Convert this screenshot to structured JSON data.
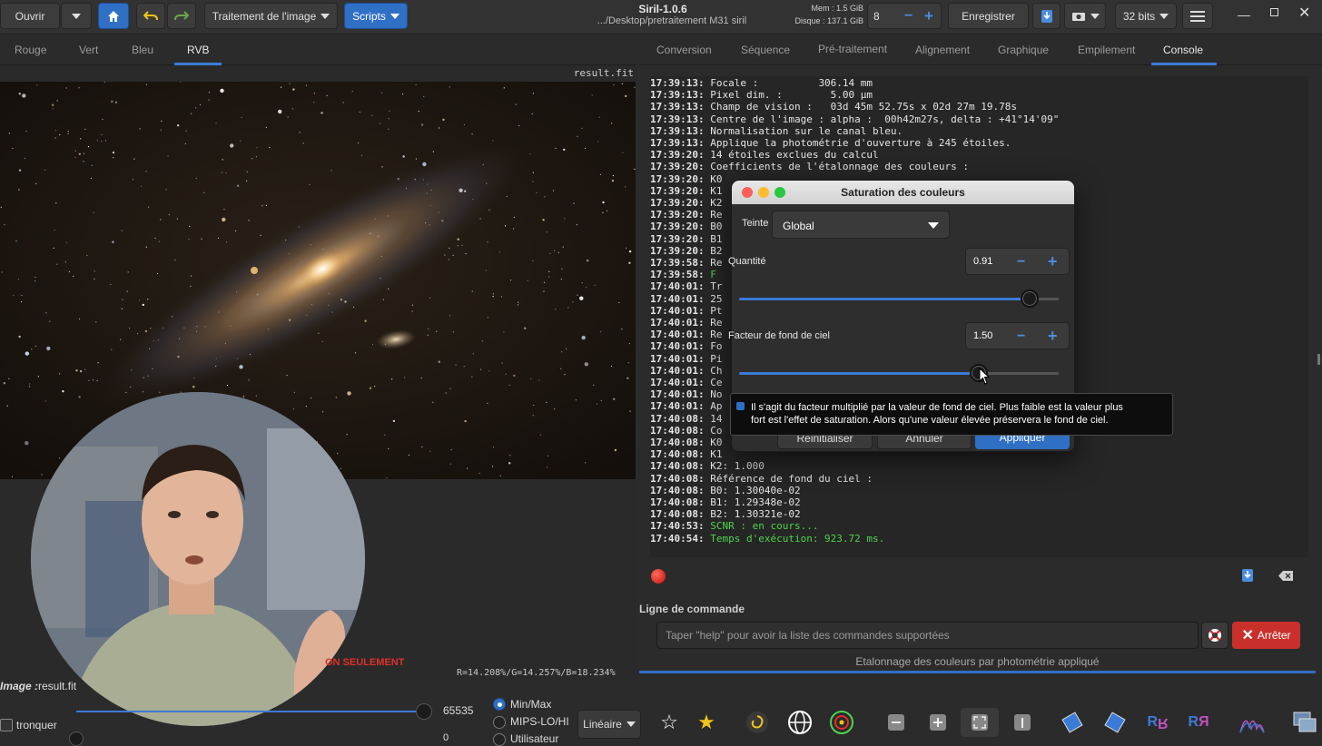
{
  "window": {
    "title": "Siril-1.0.6",
    "path": ".../Desktop/pretraitement M31 siril",
    "mem_label": "Mem : 1.5 GiB",
    "disk_label": "Disque : 137.1 GiB"
  },
  "toolbar": {
    "open_label": "Ouvrir",
    "image_processing_label": "Traitement de l'image",
    "scripts_label": "Scripts",
    "threads_value": "8",
    "save_label": "Enregistrer",
    "bits_label": "32 bits"
  },
  "left_tabs": [
    "Rouge",
    "Vert",
    "Bleu",
    "RVB"
  ],
  "right_tabs": [
    "Conversion",
    "Séquence",
    "Pré-traitement",
    "Alignement",
    "Graphique",
    "Empilement",
    "Console"
  ],
  "image": {
    "filename": "result.fit",
    "image_label_prefix": "Image :",
    "image_label_name": "result.fit",
    "rgb_readout": "R=14.208%/G=14.257%/B=18.234%",
    "red_warning": "ON SEULEMENT"
  },
  "console": {
    "lines": [
      {
        "ts": "17:39:13:",
        "text": " Focale :          306.14 mm",
        "color": "normal"
      },
      {
        "ts": "17:39:13:",
        "text": " Pixel dim. :        5.00 µm",
        "color": "normal"
      },
      {
        "ts": "17:39:13:",
        "text": " Champ de vision :   03d 45m 52.75s x 02d 27m 19.78s",
        "color": "normal"
      },
      {
        "ts": "17:39:13:",
        "text": " Centre de l'image : alpha :  00h42m27s, delta : +41°14'09\"",
        "color": "normal"
      },
      {
        "ts": "17:39:13:",
        "text": " Normalisation sur le canal bleu.",
        "color": "normal"
      },
      {
        "ts": "17:39:13:",
        "text": " Applique la photométrie d'ouverture à 245 étoiles.",
        "color": "normal"
      },
      {
        "ts": "17:39:20:",
        "text": " 14 étoiles exclues du calcul",
        "color": "normal"
      },
      {
        "ts": "17:39:20:",
        "text": " Coefficients de l'étalonnage des couleurs :",
        "color": "normal"
      },
      {
        "ts": "17:39:20:",
        "text": " K0",
        "color": "normal"
      },
      {
        "ts": "17:39:20:",
        "text": " K1",
        "color": "normal"
      },
      {
        "ts": "17:39:20:",
        "text": " K2",
        "color": "normal"
      },
      {
        "ts": "17:39:20:",
        "text": " Re",
        "color": "normal"
      },
      {
        "ts": "17:39:20:",
        "text": " B0",
        "color": "normal"
      },
      {
        "ts": "17:39:20:",
        "text": " B1",
        "color": "normal"
      },
      {
        "ts": "17:39:20:",
        "text": " B2",
        "color": "normal"
      },
      {
        "ts": "17:39:58:",
        "text": " Re",
        "color": "normal"
      },
      {
        "ts": "17:39:58:",
        "text": " F",
        "color": "green"
      },
      {
        "ts": "17:40:01:",
        "text": " Tr",
        "color": "normal"
      },
      {
        "ts": "17:40:01:",
        "text": " 25",
        "color": "normal"
      },
      {
        "ts": "17:40:01:",
        "text": " Pt",
        "color": "normal"
      },
      {
        "ts": "17:40:01:",
        "text": " Re",
        "color": "normal"
      },
      {
        "ts": "17:40:01:",
        "text": " Re",
        "color": "normal"
      },
      {
        "ts": "17:40:01:",
        "text": " Fo",
        "color": "normal"
      },
      {
        "ts": "17:40:01:",
        "text": " Pi",
        "color": "normal"
      },
      {
        "ts": "17:40:01:",
        "text": " Ch",
        "color": "normal"
      },
      {
        "ts": "17:40:01:",
        "text": " Ce",
        "color": "normal"
      },
      {
        "ts": "17:40:01:",
        "text": " No",
        "color": "normal"
      },
      {
        "ts": "17:40:01:",
        "text": " Ap",
        "color": "normal"
      },
      {
        "ts": "17:40:08:",
        "text": " 14",
        "color": "normal"
      },
      {
        "ts": "17:40:08:",
        "text": " Co",
        "color": "normal"
      },
      {
        "ts": "17:40:08:",
        "text": " K0",
        "color": "normal"
      },
      {
        "ts": "17:40:08:",
        "text": " K1",
        "color": "normal"
      },
      {
        "ts": "17:40:08:",
        "text": " K2: 1.000",
        "color": "normal"
      },
      {
        "ts": "17:40:08:",
        "text": " Référence de fond du ciel :",
        "color": "normal"
      },
      {
        "ts": "17:40:08:",
        "text": " B0: 1.30040e-02",
        "color": "normal"
      },
      {
        "ts": "17:40:08:",
        "text": " B1: 1.29348e-02",
        "color": "normal"
      },
      {
        "ts": "17:40:08:",
        "text": " B2: 1.30321e-02",
        "color": "normal"
      },
      {
        "ts": "17:40:53:",
        "text": " SCNR : en cours...",
        "color": "green"
      },
      {
        "ts": "17:40:54:",
        "text": " Temps d'exécution: 923.72 ms.",
        "color": "green"
      }
    ]
  },
  "dialog": {
    "title": "Saturation des couleurs",
    "hue_label": "Teinte :",
    "hue_value": "Global",
    "amount_label": "Quantité",
    "amount_value": "0.91",
    "amount_level": 0.91,
    "bg_label": "Facteur de fond de ciel",
    "bg_value": "1.50",
    "bg_level": 0.75,
    "reset_label": "Réinitialiser",
    "cancel_label": "Annuler",
    "apply_label": "Appliquer",
    "tooltip_line1": "Il s'agit du facteur multiplié par la valeur de fond de ciel. Plus faible est la valeur plus",
    "tooltip_line2": "fort est l'effet de saturation. Alors qu'une valeur élevée préservera le fond de ciel."
  },
  "command": {
    "section_label": "Ligne de commande",
    "placeholder": "Taper \"help\" pour avoir la liste des commandes supportées",
    "stop_label": "Arrêter",
    "status": "Etalonnage des couleurs par photométrie appliqué"
  },
  "bottom": {
    "max_value": "65535",
    "min_value": "0",
    "clip_label": "tronquer",
    "radio_minmax": "Min/Max",
    "radio_mips": "MIPS-LO/HI",
    "radio_user": "Utilisateur",
    "stretch_label": "Linéaire"
  },
  "colors": {
    "accent": "#2f6fc4",
    "green_text": "#4cd44c",
    "stop_button": "#c9302c"
  }
}
